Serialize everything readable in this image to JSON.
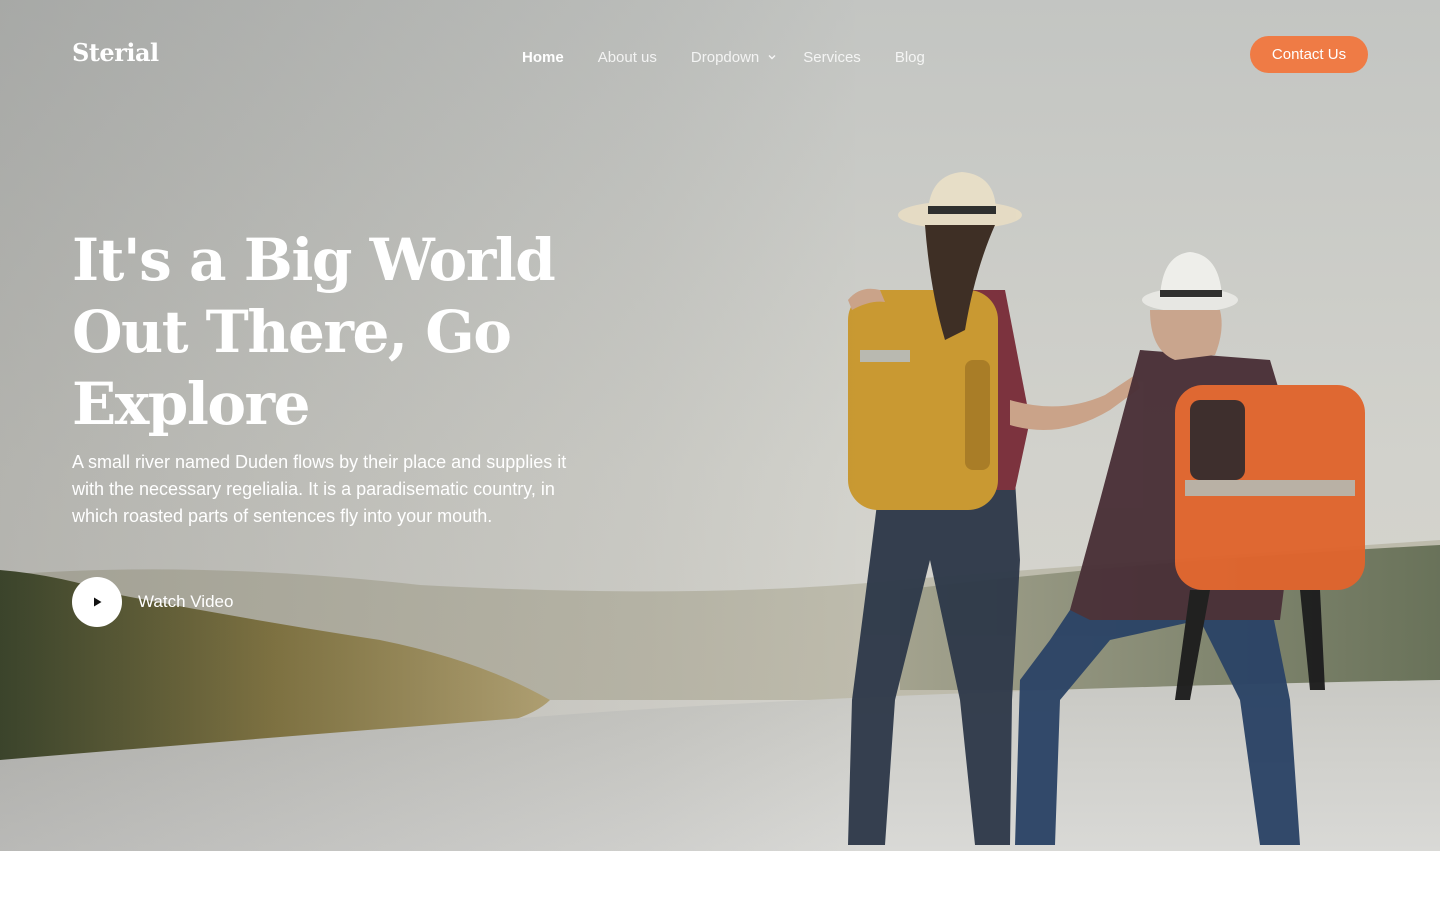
{
  "brand": {
    "name": "Sterial"
  },
  "nav": {
    "items": [
      {
        "label": "Home",
        "active": true
      },
      {
        "label": "About us"
      },
      {
        "label": "Dropdown",
        "has_dropdown": true
      },
      {
        "label": "Services"
      },
      {
        "label": "Blog"
      }
    ],
    "cta_label": "Contact Us"
  },
  "hero": {
    "headline": "It's a Big World Out There, Go Explore",
    "description": "A small river named Duden flows by their place and supplies it with the necessary regelialia. It is a paradisematic country, in which roasted parts of sentences fly into your mouth.",
    "video_label": "Watch Video"
  },
  "icons": {
    "play": "play-icon",
    "dropdown": "chevron-down-icon"
  },
  "colors": {
    "accent": "#ef7b45",
    "text_on_hero": "#ffffff"
  }
}
